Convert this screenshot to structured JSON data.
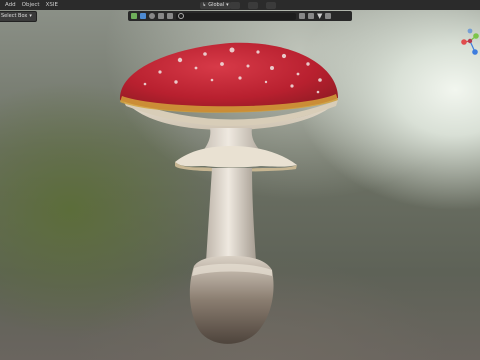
{
  "menu": {
    "items": [
      "Add",
      "Object",
      "XSIE"
    ]
  },
  "toolbar": {
    "select_mode": "Select Box",
    "transform_orientation": "Global"
  },
  "colors": {
    "menubar": "#2b2b2b",
    "header": "#282828",
    "cap_red": "#c0283a",
    "gizmo_x": "#e04c4c",
    "gizmo_y": "#7cc44a",
    "gizmo_z": "#3d7dde"
  },
  "icons": [
    "viewport-shading-icon",
    "overlays-icon",
    "search-icon",
    "filter-icon",
    "navigation-gizmo-icon"
  ]
}
